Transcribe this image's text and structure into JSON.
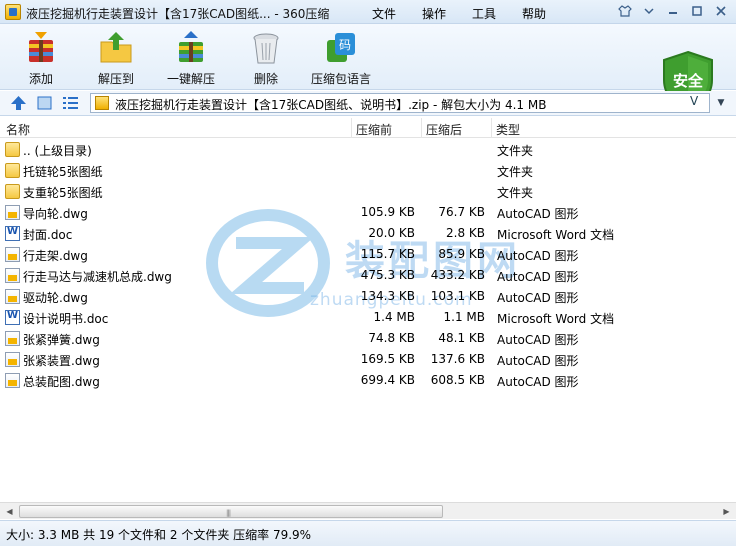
{
  "window": {
    "title": "液压挖掘机行走装置设计【含17张CAD图纸... - 360压缩",
    "menu": [
      "文件",
      "操作",
      "工具",
      "帮助"
    ]
  },
  "toolbar": {
    "add_label": "添加",
    "extract_to_label": "解压到",
    "one_click_extract_label": "一键解压",
    "delete_label": "删除",
    "language_label": "压缩包语言",
    "shield_label": "安全",
    "lang_icon_text": "码"
  },
  "address": {
    "path": "液压挖掘机行走装置设计【含17张CAD图纸、说明书】.zip - 解包大小为 4.1 MB",
    "right_glyph": "V"
  },
  "columns": {
    "name": "名称",
    "compressed": "压缩前",
    "size_after": "压缩后",
    "type": "类型"
  },
  "files": [
    {
      "name": ".. (上级目录)",
      "size": "",
      "packed": "",
      "type": "文件夹",
      "icon": "folder"
    },
    {
      "name": "托链轮5张图纸",
      "size": "",
      "packed": "",
      "type": "文件夹",
      "icon": "folder"
    },
    {
      "name": "支重轮5张图纸",
      "size": "",
      "packed": "",
      "type": "文件夹",
      "icon": "folder"
    },
    {
      "name": "导向轮.dwg",
      "size": "105.9 KB",
      "packed": "76.7 KB",
      "type": "AutoCAD 图形",
      "icon": "dwg"
    },
    {
      "name": "封面.doc",
      "size": "20.0 KB",
      "packed": "2.8 KB",
      "type": "Microsoft Word 文档",
      "icon": "doc"
    },
    {
      "name": "行走架.dwg",
      "size": "115.7 KB",
      "packed": "85.9 KB",
      "type": "AutoCAD 图形",
      "icon": "dwg"
    },
    {
      "name": "行走马达与减速机总成.dwg",
      "size": "475.3 KB",
      "packed": "433.2 KB",
      "type": "AutoCAD 图形",
      "icon": "dwg"
    },
    {
      "name": "驱动轮.dwg",
      "size": "134.3 KB",
      "packed": "103.1 KB",
      "type": "AutoCAD 图形",
      "icon": "dwg"
    },
    {
      "name": "设计说明书.doc",
      "size": "1.4 MB",
      "packed": "1.1 MB",
      "type": "Microsoft Word 文档",
      "icon": "doc"
    },
    {
      "name": "张紧弹簧.dwg",
      "size": "74.8 KB",
      "packed": "48.1 KB",
      "type": "AutoCAD 图形",
      "icon": "dwg"
    },
    {
      "name": "张紧装置.dwg",
      "size": "169.5 KB",
      "packed": "137.6 KB",
      "type": "AutoCAD 图形",
      "icon": "dwg"
    },
    {
      "name": "总装配图.dwg",
      "size": "699.4 KB",
      "packed": "608.5 KB",
      "type": "AutoCAD 图形",
      "icon": "dwg"
    }
  ],
  "watermark": {
    "text": "装配图网",
    "url": "zhuangpeitu.com"
  },
  "status": {
    "text": "大小: 3.3 MB 共 19 个文件和 2 个文件夹 压缩率 79.9%"
  },
  "colors": {
    "accent": "#2a70c8",
    "shield_green": "#3f9e2f"
  }
}
